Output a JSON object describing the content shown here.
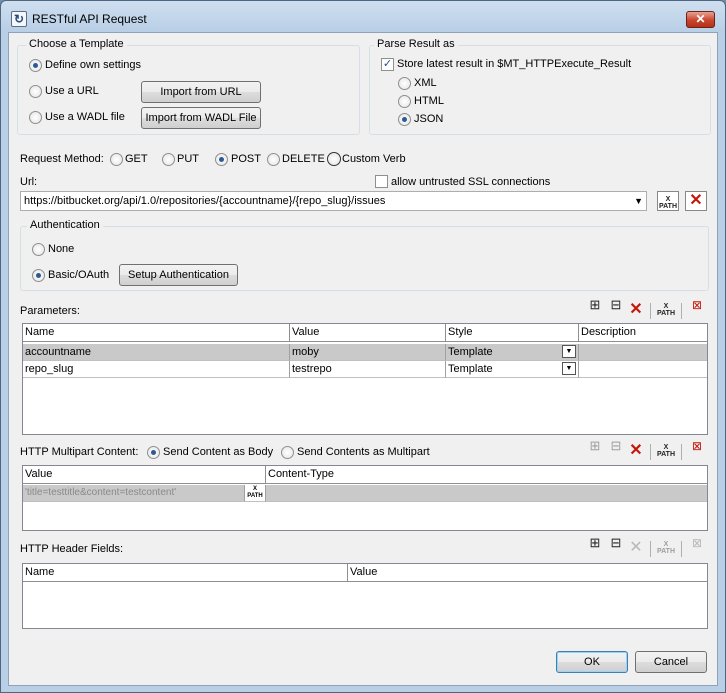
{
  "window": {
    "title": "RESTful API Request",
    "icon": "refresh-icon",
    "close_label": "✕"
  },
  "template": {
    "group_label": "Choose a Template",
    "options": [
      {
        "label": "Define own settings",
        "selected": true
      },
      {
        "label": "Use a URL",
        "selected": false
      },
      {
        "label": "Use a WADL file",
        "selected": false
      }
    ],
    "import_url_label": "Import from URL",
    "import_wadl_label": "Import from WADL File"
  },
  "parse": {
    "group_label": "Parse Result as",
    "store_label": "Store latest result in $MT_HTTPExecute_Result",
    "store_checked": true,
    "formats": [
      {
        "label": "XML",
        "selected": false
      },
      {
        "label": "HTML",
        "selected": false
      },
      {
        "label": "JSON",
        "selected": true
      }
    ]
  },
  "method": {
    "label": "Request Method:",
    "options": [
      {
        "label": "GET",
        "selected": false
      },
      {
        "label": "PUT",
        "selected": false
      },
      {
        "label": "POST",
        "selected": true
      },
      {
        "label": "DELETE",
        "selected": false
      },
      {
        "label": "Custom Verb",
        "selected": false
      }
    ]
  },
  "url": {
    "label": "Url:",
    "value": "https://bitbucket.org/api/1.0/repositories/{accountname}/{repo_slug}/issues",
    "ssl_label": "allow untrusted SSL connections",
    "ssl_checked": false
  },
  "auth": {
    "group_label": "Authentication",
    "options": [
      {
        "label": "None",
        "selected": false
      },
      {
        "label": "Basic/OAuth",
        "selected": true
      }
    ],
    "setup_label": "Setup Authentication"
  },
  "parameters": {
    "label": "Parameters:",
    "columns": [
      "Name",
      "Value",
      "Style",
      "Description"
    ],
    "rows": [
      {
        "name": "accountname",
        "value": "moby",
        "style": "Template",
        "description": ""
      },
      {
        "name": "repo_slug",
        "value": "testrepo",
        "style": "Template",
        "description": ""
      }
    ]
  },
  "multipart": {
    "label": "HTTP Multipart Content:",
    "option_body": "Send Content as Body",
    "option_multipart": "Send Contents as Multipart",
    "body_selected": true,
    "columns": [
      "Value",
      "Content-Type"
    ],
    "rows": [
      {
        "value": "'title=testtitle&content=testcontent'",
        "content_type": ""
      }
    ]
  },
  "headers": {
    "label": "HTTP Header Fields:",
    "columns": [
      "Name",
      "Value"
    ]
  },
  "toolbar": {
    "xpath_label": "X\nPATH",
    "icons": [
      "append-row-icon",
      "insert-row-icon",
      "delete-row-icon",
      "xpath-icon",
      "delete-all-icon"
    ]
  },
  "buttons": {
    "ok": "OK",
    "cancel": "Cancel"
  }
}
